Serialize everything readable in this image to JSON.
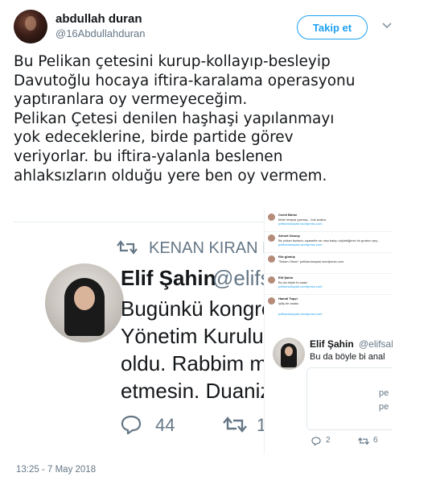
{
  "author": {
    "display_name": "abdullah duran",
    "handle": "@16Abdullahduran"
  },
  "follow_label": "Takip et",
  "tweet_lines": [
    "Bu Pelikan çetesini kurup-kollayıp-besleyip",
    "Davutoğlu hocaya iftira-karalama operasyonu",
    "yaptıranlara oy vermeyeceğim.",
    "Pelikan Çetesi denilen haşhaşi yapılanmayı",
    "yok edeceklerine, birde partide görev",
    "veriyorlar. bu iftira-yalanla beslenen",
    "ahlaksızların olduğu yere ben oy vermem."
  ],
  "quoted_large": {
    "retweeted_by": "KENAN KIRAN Ret",
    "name": "Elif Şahin",
    "handle": "@elifs",
    "lines": [
      "Bugünkü kongre",
      "Yönetim Kurulu",
      "oldu. Rabbim m",
      "etmesin. Duaniz"
    ],
    "reply_count": "44",
    "retweet_count": "1"
  },
  "quoted_small": {
    "rows": [
      {
        "name": "Cemil Bürke",
        "text": "birisi herşeyi yazmış... lınk acaba.",
        "link": "pelikandosyasi.wordpress.com"
      },
      {
        "name": "Ahmet Ulusoy",
        "text": "Bir yıldan fazladır, siyasette ne olsa bakıp söylediğimiz bir grubun şey...",
        "link": "pelikandosyasi.wordpress.com"
      },
      {
        "name": "filiz gümüş",
        "text": "\"Selam Olsun\" pelikandosyasi.wordpress.com",
        "link": ""
      },
      {
        "name": "Elif Şahin",
        "text": "Bu da böyle bi anaiz",
        "link": "pelikandosyasi.wordpress.com"
      },
      {
        "name": "Hamdi Topçi",
        "text": "İyiliş bir analiz.",
        "link": ""
      }
    ],
    "link_solo": "pelikandosyasi.wordpress.com",
    "name": "Elif Şahin",
    "handle": "@elifsah",
    "text": "Bu da böyle bi anal",
    "card_lines": [
      "pe",
      "pe"
    ],
    "reply_count": "2",
    "retweet_count": "6"
  },
  "timestamp": "13:25 - 7 May 2018"
}
